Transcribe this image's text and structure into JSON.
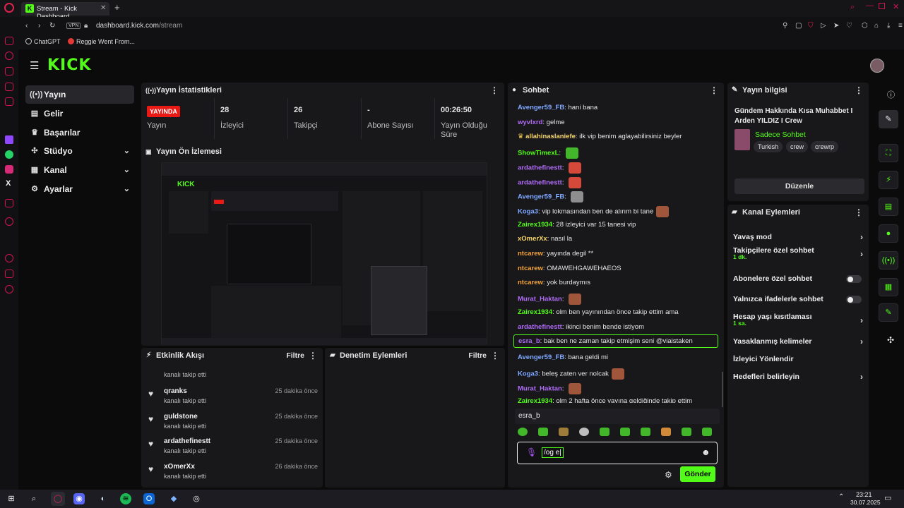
{
  "browser": {
    "tab_title": "Stream - Kick Dashboard",
    "new_tab": "+",
    "vpn": "VPN",
    "url_host": "dashboard.kick.com",
    "url_path": "/stream",
    "bookmarks": [
      "ChatGPT",
      "Reggie Went From..."
    ]
  },
  "brand": {
    "logo": "KICK",
    "accent": "#53fc18",
    "live_color": "#e91916"
  },
  "nav": {
    "items": [
      {
        "label": "Yayın",
        "icon": "broadcast-icon"
      },
      {
        "label": "Gelir",
        "icon": "money-icon"
      },
      {
        "label": "Başarılar",
        "icon": "trophy-icon"
      },
      {
        "label": "Stüdyo",
        "icon": "studio-icon"
      },
      {
        "label": "Kanal",
        "icon": "channel-icon"
      },
      {
        "label": "Ayarlar",
        "icon": "gear-icon"
      }
    ]
  },
  "stats": {
    "title": "Yayın İstatistikleri",
    "live_badge": "YAYINDA",
    "live_label": "Yayın",
    "viewers_value": "28",
    "viewers_label": "İzleyici",
    "followers_value": "26",
    "followers_label": "Takipçi",
    "subs_value": "-",
    "subs_label": "Abone Sayısı",
    "uptime_value": "00:26:50",
    "uptime_label": "Yayın Olduğu Süre"
  },
  "preview": {
    "title": "Yayın Ön İzlemesi"
  },
  "activity": {
    "title": "Etkinlik Akışı",
    "filter": "Filtre",
    "partial_sub": "kanalı takip etti",
    "rows": [
      {
        "name": "qranks",
        "sub": "kanalı takip etti",
        "time": "25 dakika önce"
      },
      {
        "name": "guldstone",
        "sub": "kanalı takip etti",
        "time": "25 dakika önce"
      },
      {
        "name": "ardathefinestt",
        "sub": "kanalı takip etti",
        "time": "25 dakika önce"
      },
      {
        "name": "xOmerXx",
        "sub": "kanalı takip etti",
        "time": "26 dakika önce"
      }
    ]
  },
  "moderation": {
    "title": "Denetim Eylemleri",
    "filter": "Filtre"
  },
  "chat": {
    "title": "Sohbet",
    "messages": [
      {
        "user": "Avenger59_FB",
        "color": "#7fa8ff",
        "text": "hani bana"
      },
      {
        "user": "wyvlxrd",
        "color": "#b06cf6",
        "text": "gelme"
      },
      {
        "user": "allahinaslaniefe",
        "color": "#f7d66b",
        "text": "ilk vip benim aglayabilirsiniz beyler",
        "badge": true
      },
      {
        "user": "ShowTimexL",
        "color": "#53fc18",
        "text": "",
        "emote": "#42b72a"
      },
      {
        "user": "ardathefinestt",
        "color": "#b06cf6",
        "text": "",
        "emote": "#d4493a"
      },
      {
        "user": "ardathefinestt",
        "color": "#b06cf6",
        "text": "",
        "emote": "#d4493a"
      },
      {
        "user": "Avenger59_FB",
        "color": "#7fa8ff",
        "text": "",
        "emote": "#8e8e8e"
      },
      {
        "user": "Koga3",
        "color": "#7fa8ff",
        "text": "vip lokmasından ben de alırım bi tane",
        "emote": "#a0563a"
      },
      {
        "user": "Zairex1934",
        "color": "#53fc18",
        "text": "28 izleyici var 15 tanesi vip"
      },
      {
        "user": "xOmerXx",
        "color": "#f7d66b",
        "text": "nasıl la"
      },
      {
        "user": "ntcarew",
        "color": "#f2a33a",
        "text": "yayında degil **"
      },
      {
        "user": "ntcarew",
        "color": "#f2a33a",
        "text": "OMAWEHGAWEHAEOS"
      },
      {
        "user": "ntcarew",
        "color": "#f2a33a",
        "text": "yok burdaymıs"
      },
      {
        "user": "Murat_Haktan",
        "color": "#b06cf6",
        "text": "",
        "emote": "#a0563a"
      },
      {
        "user": "Zairex1934",
        "color": "#53fc18",
        "text": "olm ben yayınından önce takip ettim ama"
      },
      {
        "user": "ardathefinestt",
        "color": "#b06cf6",
        "text": "ikinci benim bende istiyom"
      },
      {
        "user": "esra_b",
        "color": "#b06cf6",
        "text": "bak ben ne zaman takip etmişim seni @viaistaken",
        "highlight": true
      },
      {
        "user": "Avenger59_FB",
        "color": "#7fa8ff",
        "text": "bana geldi mi"
      },
      {
        "user": "Koga3",
        "color": "#7fa8ff",
        "text": "beleş zaten ver nolcak",
        "emote": "#a0563a"
      },
      {
        "user": "Murat_Haktan",
        "color": "#b06cf6",
        "text": "",
        "emote": "#a0563a"
      },
      {
        "user": "Zairex1934",
        "color": "#53fc18",
        "text": "olm 2 hafta önce yayına geldiğinde takip ettim"
      }
    ],
    "suggestion": "esra_b",
    "input_value": "/og e|",
    "send": "Gönder"
  },
  "stream_info": {
    "title": "Yayın bilgisi",
    "stream_title": "Gündem Hakkında Kısa Muhabbet I Arden YILDIZ I Crew",
    "category": "Sadece Sohbet",
    "tags": [
      "Turkish",
      "crew",
      "crewrp"
    ],
    "edit": "Düzenle"
  },
  "channel_actions": {
    "title": "Kanal Eylemleri",
    "rows": [
      {
        "label": "Yavaş mod",
        "kind": "arrow"
      },
      {
        "label": "Takipçilere özel sohbet",
        "sub": "1 dk.",
        "kind": "arrow"
      },
      {
        "label": "Abonelere özel sohbet",
        "kind": "toggle"
      },
      {
        "label": "Yalnızca ifadelerle sohbet",
        "kind": "toggle"
      },
      {
        "label": "Hesap yaşı kısıtlaması",
        "sub": "1 sa.",
        "kind": "arrow"
      },
      {
        "label": "Yasaklanmış kelimeler",
        "kind": "arrow"
      },
      {
        "label": "İzleyici Yönlendir",
        "kind": "none"
      },
      {
        "label": "Hedefleri belirleyin",
        "kind": "arrow"
      }
    ]
  },
  "taskbar": {
    "time": "23:21",
    "date": "30.07.2025"
  }
}
